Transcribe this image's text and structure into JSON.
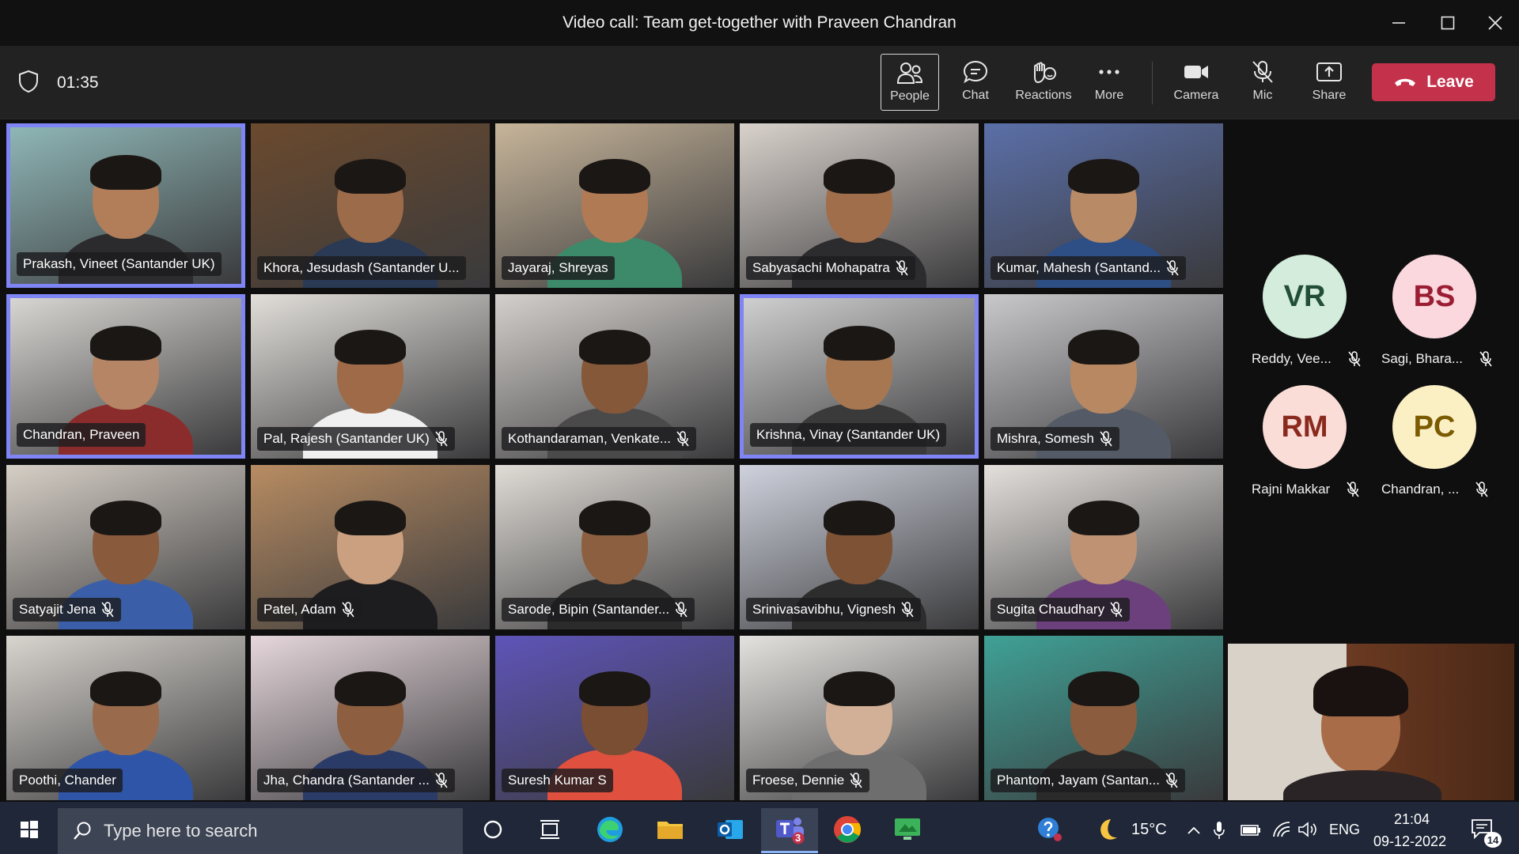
{
  "window": {
    "title": "Video call: Team get-together with Praveen Chandran",
    "minimize": "—",
    "maximize": "☐",
    "close": "✕"
  },
  "toolbar": {
    "timer": "01:35",
    "buttons": [
      "People",
      "Chat",
      "Reactions",
      "More",
      "Camera",
      "Mic",
      "Share"
    ],
    "leave": "Leave"
  },
  "participants": [
    "Prakash, Vineet (Santander UK)",
    "Khora, Jesudash (Santander U...",
    "Jayaraj, Shreyas",
    "Sabyasachi Mohapatra",
    "Kumar, Mahesh (Santand...",
    "Chandran, Praveen",
    "Pal, Rajesh (Santander UK)",
    "Kothandaraman, Venkate...",
    "Krishna, Vinay (Santander UK)",
    "Mishra, Somesh",
    "Satyajit Jena",
    "Patel, Adam",
    "Sarode, Bipin (Santander...",
    "Srinivasavibhu, Vignesh",
    "Sugita Chaudhary",
    "Poothi, Chander",
    "Jha, Chandra (Santander ...",
    "Suresh Kumar S",
    "Froese, Dennie",
    "Phantom, Jayam (Santan..."
  ],
  "avatars": [
    {
      "initials": "VR",
      "name": "Reddy, Vee...",
      "bg": "#d3ecdc",
      "fg": "#234e36"
    },
    {
      "initials": "BS",
      "name": "Sagi, Bhara...",
      "bg": "#fad8de",
      "fg": "#9b1d33"
    },
    {
      "initials": "RM",
      "name": "Rajni Makkar",
      "bg": "#f9ddd6",
      "fg": "#8a2a1e"
    },
    {
      "initials": "PC",
      "name": "Chandran, ...",
      "bg": "#fbefc4",
      "fg": "#7b5a00"
    }
  ],
  "taskbar": {
    "search_placeholder": "Type here to search",
    "teams_badge": "3",
    "temperature": "15°C",
    "language": "ENG",
    "time": "21:04",
    "date": "09-12-2022",
    "notifications": "14"
  },
  "colors": {
    "leave": "#c4314b",
    "spotlight": "#7f85f5"
  }
}
